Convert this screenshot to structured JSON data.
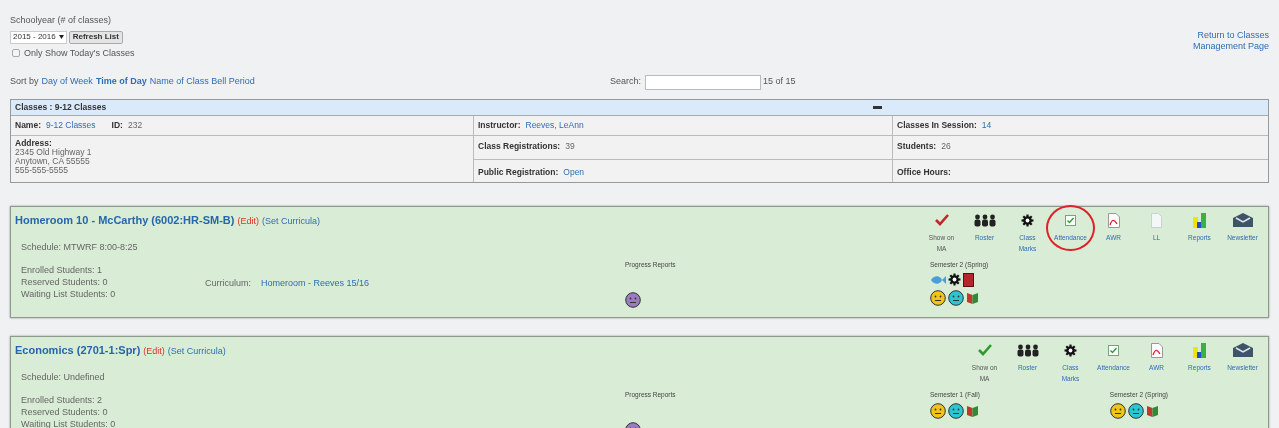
{
  "filters": {
    "schoolyear_label": "Schoolyear (# of classes)",
    "year_select": "2015 - 2016",
    "refresh_button": "Refresh List",
    "today_only": {
      "label": "Only Show Today's Classes",
      "checked": false
    }
  },
  "return_link": "Return to Classes Management Page",
  "sort": {
    "label": "Sort by",
    "options": [
      {
        "label": "Day of Week",
        "selected": false
      },
      {
        "label": "Time of Day",
        "selected": true
      },
      {
        "label": "Name of Class Bell Period",
        "selected": false
      }
    ]
  },
  "search": {
    "label": "Search:",
    "count": "15 of 15"
  },
  "group": {
    "title": "Classes : 9-12 Classes",
    "name": {
      "label": "Name:",
      "value": "9-12 Classes"
    },
    "id": {
      "label": "ID:",
      "value": "232"
    },
    "instructor": {
      "label": "Instructor:",
      "value": "Reeves, LeAnn"
    },
    "classes_in_session": {
      "label": "Classes In Session:",
      "value": "14"
    },
    "address": {
      "label": "Address:",
      "lines": [
        "2345 Old Highway 1",
        "Anytown, CA 55555",
        "555-555-5555"
      ]
    },
    "class_registrations": {
      "label": "Class Registrations:",
      "value": "39"
    },
    "students": {
      "label": "Students:",
      "value": "26"
    },
    "public_registration": {
      "label": "Public Registration:",
      "value": "Open"
    },
    "office_hours": {
      "label": "Office Hours:"
    }
  },
  "classes": [
    {
      "title": "Homeroom 10 - McCarthy (6002:HR-SM-B)",
      "edit": "(Edit)",
      "set_curricula": "(Set Curricula)",
      "schedule": "Schedule: MTWRF 8:00-8:25",
      "enrollment": [
        "Enrolled Students: 1",
        "Reserved Students: 0",
        "Waiting List Students: 0"
      ],
      "curriculum": {
        "label": "Curriculum:",
        "value": "Homeroom - Reeves 15/16"
      },
      "progress_reports": {
        "label": "Progress Reports",
        "icons": [
          {
            "kind": "face",
            "color": "#9a7cc0"
          }
        ]
      },
      "semesters": [
        {
          "label": "Semester 2 (Spring)",
          "icon_rows": [
            [
              {
                "kind": "fish"
              },
              {
                "kind": "gear"
              },
              {
                "kind": "red-book"
              }
            ],
            [
              {
                "kind": "face",
                "color": "#f0c419"
              },
              {
                "kind": "face",
                "color": "#2cc6d0"
              },
              {
                "kind": "book"
              }
            ]
          ]
        }
      ],
      "actions": [
        {
          "kind": "check",
          "label": "Show on MA",
          "on": false
        },
        {
          "kind": "roster",
          "label": "Roster"
        },
        {
          "kind": "gear",
          "label": "Class Marks"
        },
        {
          "kind": "attendance",
          "label": "Attendance",
          "highlighted": true
        },
        {
          "kind": "pdf",
          "label": "AWR"
        },
        {
          "kind": "file",
          "label": "LL"
        },
        {
          "kind": "reports",
          "label": "Reports"
        },
        {
          "kind": "newsletter",
          "label": "Newsletter"
        }
      ]
    },
    {
      "title": "Economics (2701-1:Spr)",
      "edit": "(Edit)",
      "set_curricula": "(Set Curricula)",
      "schedule": "Schedule: Undefined",
      "enrollment": [
        "Enrolled Students: 2",
        "Reserved Students: 0",
        "Waiting List Students: 0"
      ],
      "progress_reports": {
        "label": "Progress Reports",
        "icons": [
          {
            "kind": "face",
            "color": "#9a7cc0"
          }
        ]
      },
      "semesters": [
        {
          "label": "Semester 1 (Fall)",
          "icon_rows": [
            [
              {
                "kind": "face",
                "color": "#f0c419"
              },
              {
                "kind": "face",
                "color": "#2cc6d0"
              },
              {
                "kind": "book"
              }
            ]
          ]
        },
        {
          "label": "Semester 2 (Spring)",
          "icon_rows": [
            [
              {
                "kind": "face",
                "color": "#f0c419"
              },
              {
                "kind": "face",
                "color": "#2cc6d0"
              },
              {
                "kind": "book"
              }
            ]
          ]
        }
      ],
      "actions": [
        {
          "kind": "check",
          "label": "Show on MA",
          "on": true
        },
        {
          "kind": "roster",
          "label": "Roster"
        },
        {
          "kind": "gear",
          "label": "Class Marks"
        },
        {
          "kind": "attendance",
          "label": "Attendance",
          "highlighted": false
        },
        {
          "kind": "pdf",
          "label": "AWR"
        },
        {
          "kind": "reports",
          "label": "Reports"
        },
        {
          "kind": "newsletter",
          "label": "Newsletter"
        }
      ]
    }
  ]
}
